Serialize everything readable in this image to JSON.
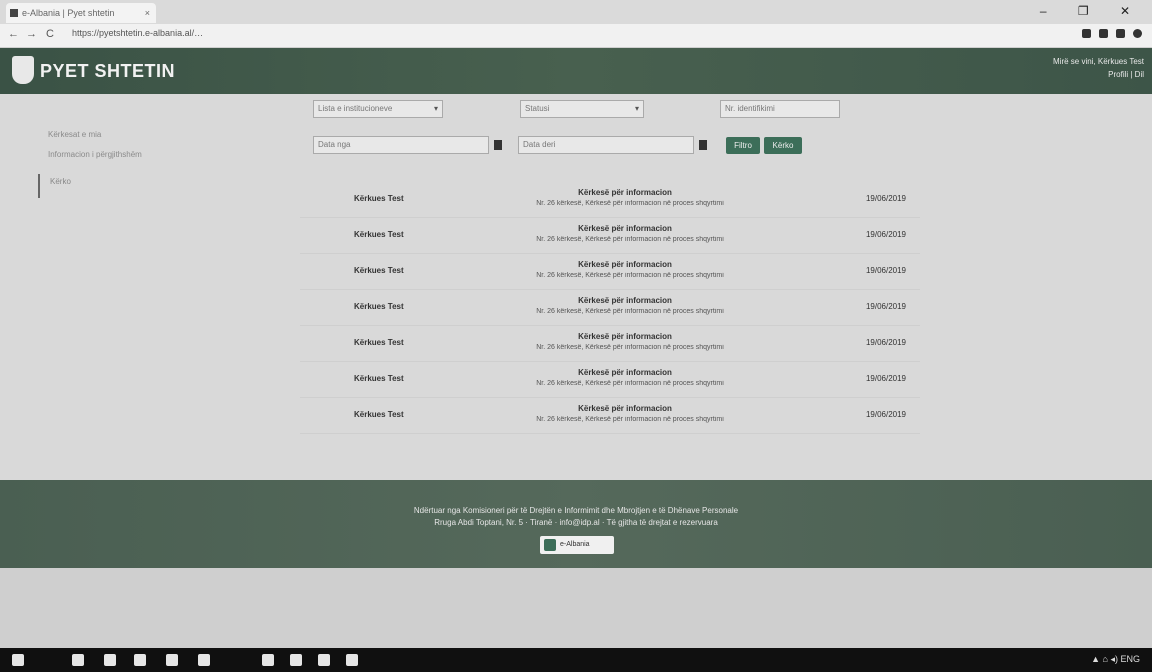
{
  "browser": {
    "tab_title": "e-Albania | Pyet shtetin",
    "tab_close": "×",
    "window_controls": "– ❐ ✕",
    "url": "https://pyetshtetin.e-albania.al/…",
    "nav_back": "←",
    "nav_forward": "→",
    "nav_reload": "C"
  },
  "header": {
    "logo_text": "PYET SHTETIN",
    "user_line1": "Mirë se vini, Kërkues Test",
    "user_line2": "Profili | Dil"
  },
  "sidebar": {
    "items": [
      {
        "label": "Kërkesat e mia"
      },
      {
        "label": "Informacion i përgjithshëm"
      },
      {
        "label": "Kërko"
      }
    ]
  },
  "filters": {
    "institution_select": "Lista e institucioneve",
    "status_select": "Statusi",
    "id_placeholder": "Nr. identifikimi",
    "date_from": "Data nga",
    "date_to": "Data deri",
    "filter_button": "Filtro",
    "search_button": "Kërko"
  },
  "requests": [
    {
      "sender": "Kërkues Test",
      "title": "Kërkesë për informacion",
      "desc": "Nr. 26 kërkesë, Kërkesë për informacion në proces shqyrtimi",
      "date": "19/06/2019"
    },
    {
      "sender": "Kërkues Test",
      "title": "Kërkesë për informacion",
      "desc": "Nr. 26 kërkesë, Kërkesë për informacion në proces shqyrtimi",
      "date": "19/06/2019"
    },
    {
      "sender": "Kërkues Test",
      "title": "Kërkesë për informacion",
      "desc": "Nr. 26 kërkesë, Kërkesë për informacion në proces shqyrtimi",
      "date": "19/06/2019"
    },
    {
      "sender": "Kërkues Test",
      "title": "Kërkesë për informacion",
      "desc": "Nr. 26 kërkesë, Kërkesë për informacion në proces shqyrtimi",
      "date": "19/06/2019"
    },
    {
      "sender": "Kërkues Test",
      "title": "Kërkesë për informacion",
      "desc": "Nr. 26 kërkesë, Kërkesë për informacion në proces shqyrtimi",
      "date": "19/06/2019"
    },
    {
      "sender": "Kërkues Test",
      "title": "Kërkesë për informacion",
      "desc": "Nr. 26 kërkesë, Kërkesë për informacion në proces shqyrtimi",
      "date": "19/06/2019"
    },
    {
      "sender": "Kërkues Test",
      "title": "Kërkesë për informacion",
      "desc": "Nr. 26 kërkesë, Kërkesë për informacion në proces shqyrtimi",
      "date": "19/06/2019"
    }
  ],
  "footer": {
    "line1": "Ndërtuar nga Komisioneri për të Drejtën e Informimit dhe Mbrojtjen e të Dhënave Personale",
    "line2": "Rruga Abdi Toptani, Nr. 5 · Tiranë · info@idp.al · Të gjitha të drejtat e rezervuara",
    "badge": "e-Albania"
  },
  "taskbar": {
    "tray": "▲ ⌂ ◂) ENG"
  },
  "colors": {
    "header_bg": "#48604f",
    "footer_bg": "#55695b",
    "accent": "#3c6e59"
  }
}
